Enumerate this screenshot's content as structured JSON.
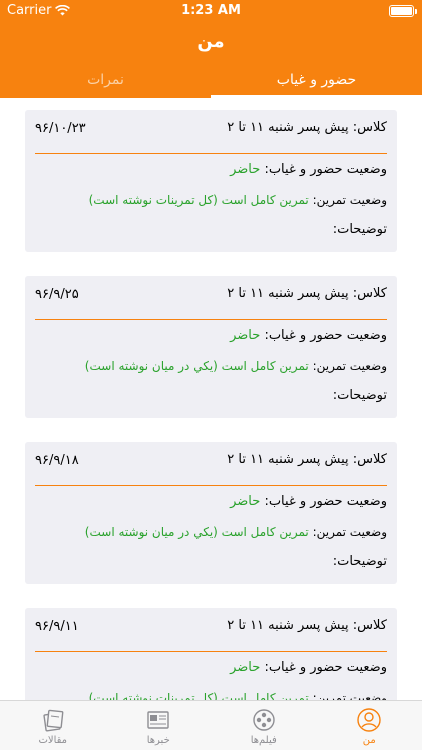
{
  "status": {
    "carrier": "Carrier",
    "time": "1:23 AM"
  },
  "nav": {
    "title": "من"
  },
  "tabs": [
    {
      "label": "حضور و غیاب",
      "active": true
    },
    {
      "label": "نمرات",
      "active": false
    }
  ],
  "labels": {
    "class_prefix": "کلاس:",
    "attendance": "وضعیت حضور و غیاب:",
    "exercise": "وضعیت تمرین:",
    "notes": "توضیحات:"
  },
  "cards": [
    {
      "class_name": "پیش پسر شنبه ۱۱ تا ۲",
      "date": "۹۶/۱۰/۲۳",
      "attendance": "حاضر",
      "exercise": "تمرین کامل است (کل تمرینات نوشته است)",
      "notes": ""
    },
    {
      "class_name": "پیش پسر شنبه ۱۱ تا ۲",
      "date": "۹۶/۹/۲۵",
      "attendance": "حاضر",
      "exercise": "تمرین کامل است (يکي در ميان نوشته است)",
      "notes": ""
    },
    {
      "class_name": "پیش پسر شنبه ۱۱ تا ۲",
      "date": "۹۶/۹/۱۸",
      "attendance": "حاضر",
      "exercise": "تمرین کامل است (يکي در ميان نوشته است)",
      "notes": ""
    },
    {
      "class_name": "پیش پسر شنبه ۱۱ تا ۲",
      "date": "۹۶/۹/۱۱",
      "attendance": "حاضر",
      "exercise": "تمرین کامل است (کل تمرینات نوشته است)",
      "notes": ""
    }
  ],
  "tabbar": [
    {
      "label": "مقالات",
      "icon": "articles-icon",
      "active": false
    },
    {
      "label": "خبرها",
      "icon": "news-icon",
      "active": false
    },
    {
      "label": "فیلم‌ها",
      "icon": "film-reel-icon",
      "active": false
    },
    {
      "label": "من",
      "icon": "user-icon",
      "active": true
    }
  ],
  "colors": {
    "accent": "#f7820f",
    "value_green": "#2aa22c",
    "card_bg": "#efeff4"
  }
}
